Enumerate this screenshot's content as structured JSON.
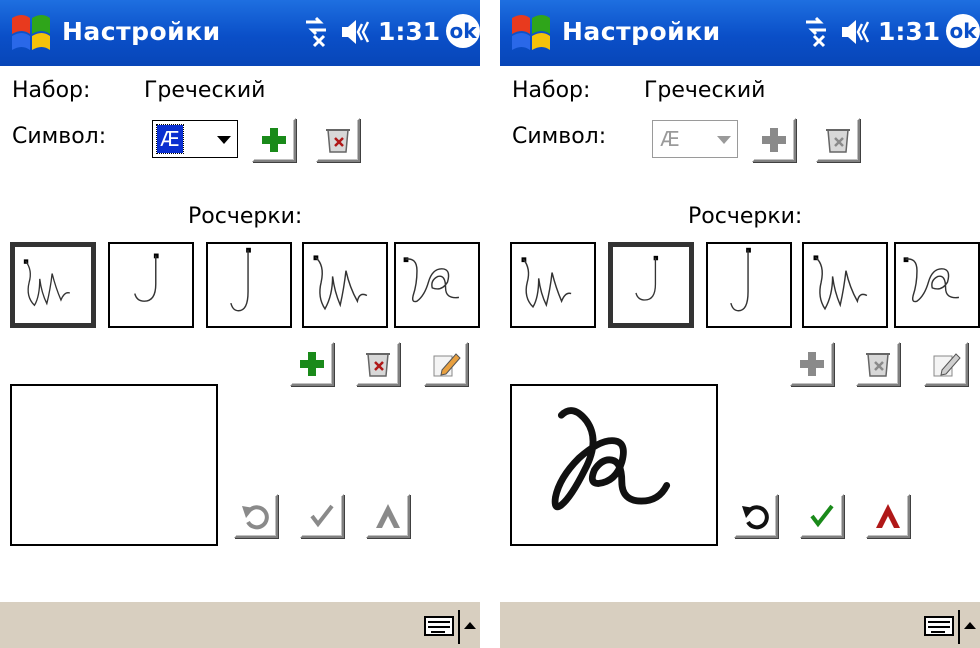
{
  "screens": [
    {
      "state": "enabled",
      "title": "Настройки",
      "time": "1:31",
      "ok": "ok",
      "set_label": "Набор:",
      "set_value": "Греческий",
      "symbol_label": "Символ:",
      "symbol_value": "Æ",
      "strokes_label": "Росчерки:",
      "selected_stroke": 0
    },
    {
      "state": "drawing",
      "title": "Настройки",
      "time": "1:31",
      "ok": "ok",
      "set_label": "Набор:",
      "set_value": "Греческий",
      "symbol_label": "Символ:",
      "symbol_value": "Æ",
      "strokes_label": "Росчерки:",
      "selected_stroke": 1
    }
  ],
  "icons": {
    "add": "plus-icon",
    "delete": "trash-icon",
    "edit": "pencil-icon",
    "undo": "undo-icon",
    "accept": "check-icon",
    "cancel": "x-icon",
    "keyboard": "keyboard-icon"
  },
  "colors": {
    "titlebar": "#0a4fc8",
    "bottombar": "#d8cfc0",
    "add_green": "#1a8a1a",
    "cancel_red": "#b01818"
  }
}
